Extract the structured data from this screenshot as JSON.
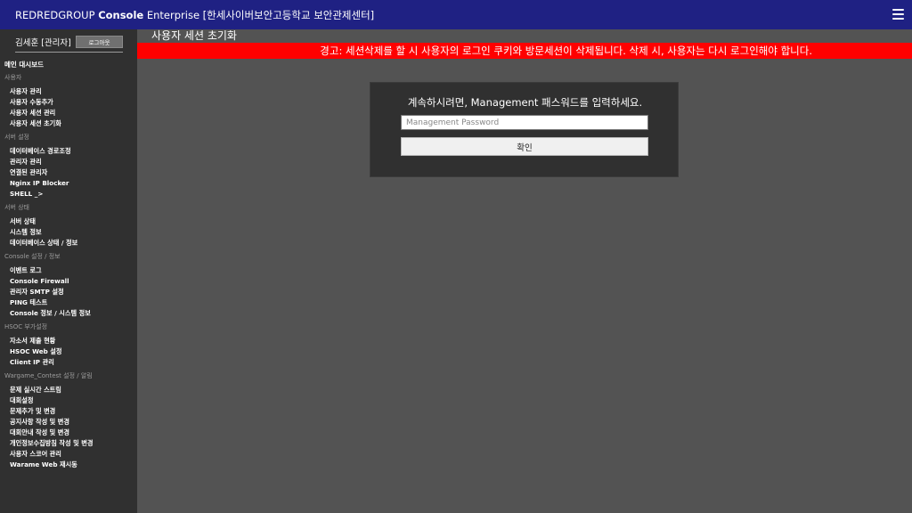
{
  "header": {
    "brand_part1": "REDREDGROUP",
    "brand_part2": "Console",
    "brand_part3": "Enterprise [한세사이버보안고등학교 보안관제센터]",
    "menu_icon": "hamburger-icon"
  },
  "sidebar": {
    "user_name": "김세훈 [관리자]",
    "logout_label": "로그아웃",
    "main_dashboard": "메인 대시보드",
    "sections": [
      {
        "title": "사용자",
        "items": [
          "사용자 관리",
          "사용자 수동추가",
          "사용자 세션 관리",
          "사용자 세션 초기화"
        ]
      },
      {
        "title": "서버 설정",
        "items": [
          "데이터베이스 경로조정",
          "관리자 관리",
          "연결된 관리자",
          "Nginx IP Blocker",
          "SHELL _>"
        ]
      },
      {
        "title": "서버 상태",
        "items": [
          "서버 상태",
          "시스템 정보",
          "데이터베이스 상태 / 정보"
        ]
      },
      {
        "title": "Console 설정 / 정보",
        "items": [
          "이벤트 로그",
          "Console Firewall",
          "관리자 SMTP 설정",
          "PING 테스트",
          "Console 정보 / 시스템 정보"
        ]
      },
      {
        "title": "HSOC 부가설정",
        "items": [
          "자소서 제출 현황",
          "HSOC Web 설정",
          "Client IP 관리"
        ]
      },
      {
        "title": "Wargame_Contest 설정 / 알림",
        "items": [
          "문제 실시간 스트림",
          "대회설정",
          "문제추가 및 변경",
          "공지사항 작성 및 변경",
          "대회안내 작성 및 변경",
          "개인정보수집방침 작성 및 변경",
          "사용자 스코어 관리",
          "Warame Web 재시동"
        ]
      }
    ]
  },
  "main": {
    "page_title": "사용자 세션 초기화",
    "warning_text": "경고: 세션삭제를 할 시 사용자의 로그인 쿠키와 방문세션이 삭제됩니다. 삭제 시, 사용자는 다시 로그인해야 합니다.",
    "dialog": {
      "prompt": "계속하시려면, Management 패스워드를 입력하세요.",
      "password_placeholder": "Management Password",
      "password_value": "",
      "confirm_label": "확인"
    }
  },
  "colors": {
    "header_bg": "#1f2183",
    "sidebar_bg": "#303030",
    "content_bg": "#535353",
    "warning_bg": "#ff0000",
    "dialog_bg": "#303030"
  }
}
